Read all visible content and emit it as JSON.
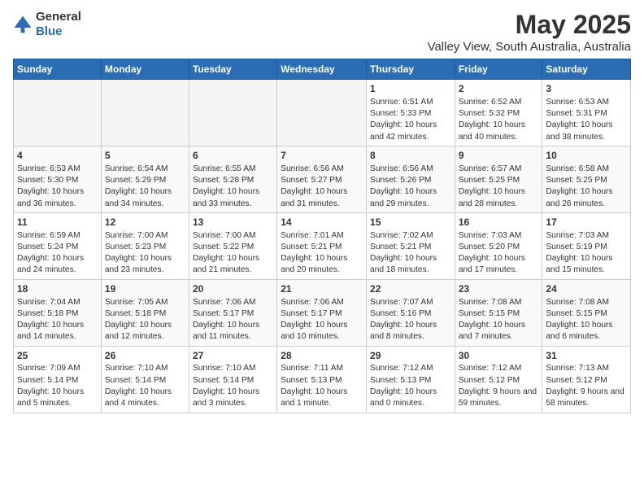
{
  "header": {
    "logo_general": "General",
    "logo_blue": "Blue",
    "title": "May 2025",
    "subtitle": "Valley View, South Australia, Australia"
  },
  "days_of_week": [
    "Sunday",
    "Monday",
    "Tuesday",
    "Wednesday",
    "Thursday",
    "Friday",
    "Saturday"
  ],
  "weeks": [
    [
      {
        "day": "",
        "info": ""
      },
      {
        "day": "",
        "info": ""
      },
      {
        "day": "",
        "info": ""
      },
      {
        "day": "",
        "info": ""
      },
      {
        "day": "1",
        "sunrise": "6:51 AM",
        "sunset": "5:33 PM",
        "daylight": "10 hours and 42 minutes."
      },
      {
        "day": "2",
        "sunrise": "6:52 AM",
        "sunset": "5:32 PM",
        "daylight": "10 hours and 40 minutes."
      },
      {
        "day": "3",
        "sunrise": "6:53 AM",
        "sunset": "5:31 PM",
        "daylight": "10 hours and 38 minutes."
      }
    ],
    [
      {
        "day": "4",
        "sunrise": "6:53 AM",
        "sunset": "5:30 PM",
        "daylight": "10 hours and 36 minutes."
      },
      {
        "day": "5",
        "sunrise": "6:54 AM",
        "sunset": "5:29 PM",
        "daylight": "10 hours and 34 minutes."
      },
      {
        "day": "6",
        "sunrise": "6:55 AM",
        "sunset": "5:28 PM",
        "daylight": "10 hours and 33 minutes."
      },
      {
        "day": "7",
        "sunrise": "6:56 AM",
        "sunset": "5:27 PM",
        "daylight": "10 hours and 31 minutes."
      },
      {
        "day": "8",
        "sunrise": "6:56 AM",
        "sunset": "5:26 PM",
        "daylight": "10 hours and 29 minutes."
      },
      {
        "day": "9",
        "sunrise": "6:57 AM",
        "sunset": "5:25 PM",
        "daylight": "10 hours and 28 minutes."
      },
      {
        "day": "10",
        "sunrise": "6:58 AM",
        "sunset": "5:25 PM",
        "daylight": "10 hours and 26 minutes."
      }
    ],
    [
      {
        "day": "11",
        "sunrise": "6:59 AM",
        "sunset": "5:24 PM",
        "daylight": "10 hours and 24 minutes."
      },
      {
        "day": "12",
        "sunrise": "7:00 AM",
        "sunset": "5:23 PM",
        "daylight": "10 hours and 23 minutes."
      },
      {
        "day": "13",
        "sunrise": "7:00 AM",
        "sunset": "5:22 PM",
        "daylight": "10 hours and 21 minutes."
      },
      {
        "day": "14",
        "sunrise": "7:01 AM",
        "sunset": "5:21 PM",
        "daylight": "10 hours and 20 minutes."
      },
      {
        "day": "15",
        "sunrise": "7:02 AM",
        "sunset": "5:21 PM",
        "daylight": "10 hours and 18 minutes."
      },
      {
        "day": "16",
        "sunrise": "7:03 AM",
        "sunset": "5:20 PM",
        "daylight": "10 hours and 17 minutes."
      },
      {
        "day": "17",
        "sunrise": "7:03 AM",
        "sunset": "5:19 PM",
        "daylight": "10 hours and 15 minutes."
      }
    ],
    [
      {
        "day": "18",
        "sunrise": "7:04 AM",
        "sunset": "5:18 PM",
        "daylight": "10 hours and 14 minutes."
      },
      {
        "day": "19",
        "sunrise": "7:05 AM",
        "sunset": "5:18 PM",
        "daylight": "10 hours and 12 minutes."
      },
      {
        "day": "20",
        "sunrise": "7:06 AM",
        "sunset": "5:17 PM",
        "daylight": "10 hours and 11 minutes."
      },
      {
        "day": "21",
        "sunrise": "7:06 AM",
        "sunset": "5:17 PM",
        "daylight": "10 hours and 10 minutes."
      },
      {
        "day": "22",
        "sunrise": "7:07 AM",
        "sunset": "5:16 PM",
        "daylight": "10 hours and 8 minutes."
      },
      {
        "day": "23",
        "sunrise": "7:08 AM",
        "sunset": "5:15 PM",
        "daylight": "10 hours and 7 minutes."
      },
      {
        "day": "24",
        "sunrise": "7:08 AM",
        "sunset": "5:15 PM",
        "daylight": "10 hours and 6 minutes."
      }
    ],
    [
      {
        "day": "25",
        "sunrise": "7:09 AM",
        "sunset": "5:14 PM",
        "daylight": "10 hours and 5 minutes."
      },
      {
        "day": "26",
        "sunrise": "7:10 AM",
        "sunset": "5:14 PM",
        "daylight": "10 hours and 4 minutes."
      },
      {
        "day": "27",
        "sunrise": "7:10 AM",
        "sunset": "5:14 PM",
        "daylight": "10 hours and 3 minutes."
      },
      {
        "day": "28",
        "sunrise": "7:11 AM",
        "sunset": "5:13 PM",
        "daylight": "10 hours and 1 minute."
      },
      {
        "day": "29",
        "sunrise": "7:12 AM",
        "sunset": "5:13 PM",
        "daylight": "10 hours and 0 minutes."
      },
      {
        "day": "30",
        "sunrise": "7:12 AM",
        "sunset": "5:12 PM",
        "daylight": "9 hours and 59 minutes."
      },
      {
        "day": "31",
        "sunrise": "7:13 AM",
        "sunset": "5:12 PM",
        "daylight": "9 hours and 58 minutes."
      }
    ]
  ]
}
